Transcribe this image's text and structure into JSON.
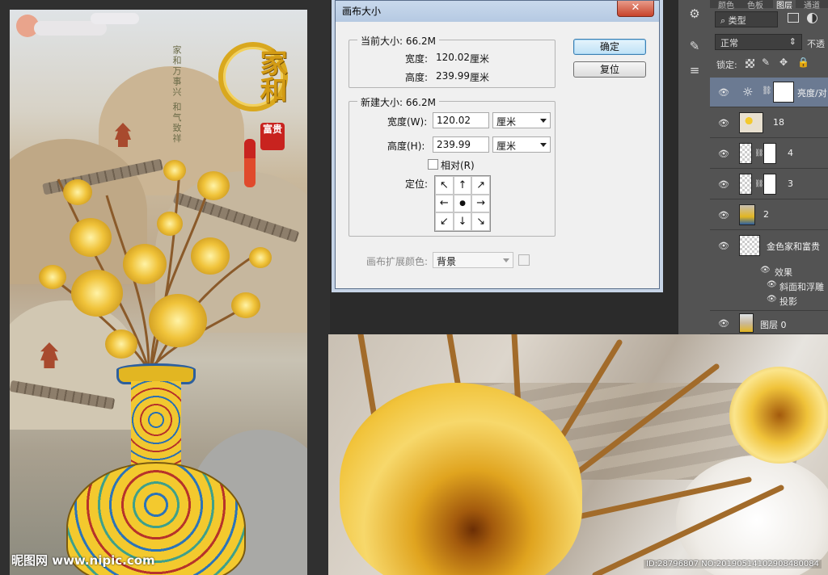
{
  "dialog": {
    "title": "画布大小",
    "close_label": "✕",
    "current": {
      "group_title": "当前大小: 66.2M",
      "width_label": "宽度:",
      "width_value": "120.02",
      "width_unit": "厘米",
      "height_label": "高度:",
      "height_value": "239.99",
      "height_unit": "厘米"
    },
    "new": {
      "group_title": "新建大小: 66.2M",
      "width_label": "宽度(W):",
      "width_value": "120.02",
      "width_unit": "厘米",
      "height_label": "高度(H):",
      "height_value": "239.99",
      "height_unit": "厘米",
      "relative_label": "相对(R)",
      "anchor_label": "定位:"
    },
    "anchor_arrows": [
      "↖",
      "↑",
      "↗",
      "←",
      "●",
      "→",
      "↙",
      "↓",
      "↘"
    ],
    "extension_label": "画布扩展颜色:",
    "extension_value": "背景",
    "ok_label": "确定",
    "reset_label": "复位"
  },
  "layers_panel": {
    "tabs": [
      "颜色",
      "色板",
      "图层",
      "通道"
    ],
    "filter_label": "类型",
    "blend_mode": "正常",
    "opacity_label": "不透",
    "lock_label": "锁定:",
    "layers": [
      {
        "name": "亮度/对",
        "selected": true
      },
      {
        "name": "18",
        "selected": false
      },
      {
        "name": "4",
        "selected": false
      },
      {
        "name": "3",
        "selected": false
      },
      {
        "name": "2",
        "selected": false
      },
      {
        "name": "金色家和富贵",
        "selected": false
      }
    ],
    "effects_label": "效果",
    "effects": [
      "斜面和浮雕",
      "投影"
    ],
    "bottom_layer": "图层 0"
  },
  "artwork": {
    "calligraphy_main": "家和",
    "calligraphy_small": "富贵",
    "poem": "家和万事兴 和气致祥",
    "watermark_left": "昵图网 www.nipic.com",
    "watermark_right": "ID:28796807 NO:20190514102908480084"
  },
  "colors": {
    "dialog_bg": "#f0f0f0",
    "panel_bg": "#535353",
    "selected_layer": "#6b7a92",
    "gold": "#e8b923"
  }
}
